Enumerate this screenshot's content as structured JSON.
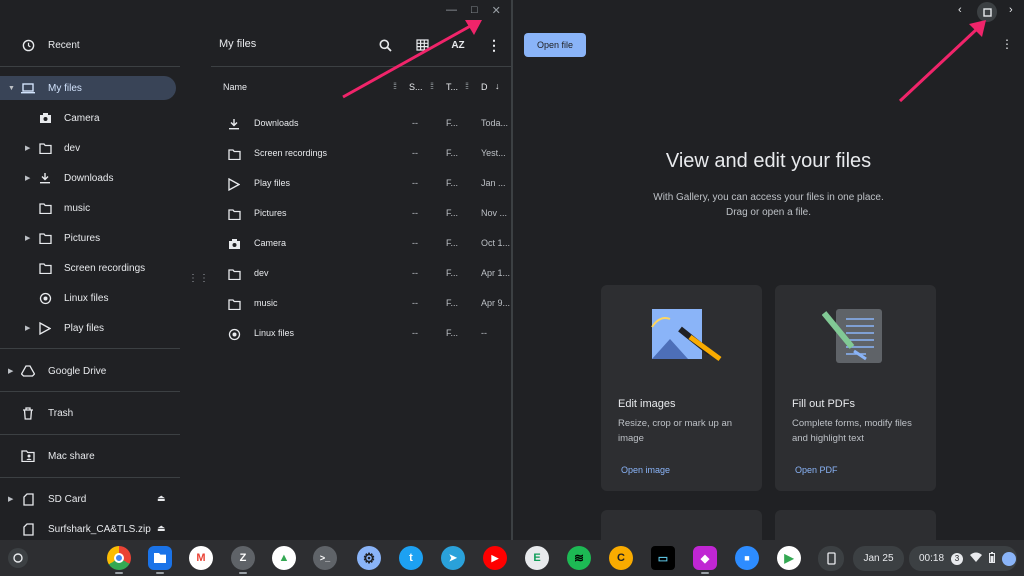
{
  "files": {
    "title": "My files",
    "sidebar": {
      "items": [
        {
          "label": "Recent",
          "icon": "clock-icon"
        },
        {
          "label": "My files",
          "icon": "laptop-icon"
        },
        {
          "label": "Camera",
          "icon": "camera-icon"
        },
        {
          "label": "dev",
          "icon": "folder-icon"
        },
        {
          "label": "Downloads",
          "icon": "download-icon"
        },
        {
          "label": "music",
          "icon": "folder-icon"
        },
        {
          "label": "Pictures",
          "icon": "folder-icon"
        },
        {
          "label": "Screen recordings",
          "icon": "folder-icon"
        },
        {
          "label": "Linux files",
          "icon": "penguin-icon"
        },
        {
          "label": "Play files",
          "icon": "play-store-icon"
        },
        {
          "label": "Google Drive",
          "icon": "drive-icon"
        },
        {
          "label": "Trash",
          "icon": "trash-icon"
        },
        {
          "label": "Mac share",
          "icon": "shared-folder-icon"
        },
        {
          "label": "SD Card",
          "icon": "sd-card-icon"
        },
        {
          "label": "Surfshark_CA&TLS.zip",
          "icon": "zip-icon"
        }
      ]
    },
    "columns": {
      "name": "Name",
      "size": "S...",
      "type": "T...",
      "date": "D"
    },
    "rows": [
      {
        "name": "Downloads",
        "size": "--",
        "type": "F...",
        "date": "Toda..."
      },
      {
        "name": "Screen recordings",
        "size": "--",
        "type": "F...",
        "date": "Yest..."
      },
      {
        "name": "Play files",
        "size": "--",
        "type": "F...",
        "date": "Jan ..."
      },
      {
        "name": "Pictures",
        "size": "--",
        "type": "F...",
        "date": "Nov ..."
      },
      {
        "name": "Camera",
        "size": "--",
        "type": "F...",
        "date": "Oct 1..."
      },
      {
        "name": "dev",
        "size": "--",
        "type": "F...",
        "date": "Apr 1..."
      },
      {
        "name": "music",
        "size": "--",
        "type": "F...",
        "date": "Apr 9..."
      },
      {
        "name": "Linux files",
        "size": "--",
        "type": "F...",
        "date": "--"
      }
    ],
    "sort_label": "AZ"
  },
  "gallery": {
    "open_button": "Open file",
    "heading": "View and edit your files",
    "subtitle_line1": "With Gallery, you can access your files in one place.",
    "subtitle_line2": "Drag or open a file.",
    "cards": [
      {
        "title": "Edit images",
        "desc": "Resize, crop or mark up an image",
        "link": "Open image"
      },
      {
        "title": "Fill out PDFs",
        "desc": "Complete forms, modify files and highlight text",
        "link": "Open PDF"
      }
    ]
  },
  "shelf": {
    "apps": [
      {
        "name": "chrome",
        "color": "#4285f4",
        "glyph": ""
      },
      {
        "name": "files",
        "color": "#1a73e8",
        "glyph": ""
      },
      {
        "name": "gmail",
        "color": "#ffffff",
        "glyph": "M"
      },
      {
        "name": "z",
        "color": "#5f6368",
        "glyph": "Z"
      },
      {
        "name": "drive",
        "color": "#ffffff",
        "glyph": "▲"
      },
      {
        "name": "terminal",
        "color": "#5f6368",
        "glyph": ">_"
      },
      {
        "name": "settings",
        "color": "#8ab4f8",
        "glyph": "⚙"
      },
      {
        "name": "twitter",
        "color": "#1da1f2",
        "glyph": "t"
      },
      {
        "name": "telegram",
        "color": "#2aa1da",
        "glyph": "➤"
      },
      {
        "name": "youtube",
        "color": "#ff0000",
        "glyph": "▶"
      },
      {
        "name": "e",
        "color": "#e8eaed",
        "glyph": "E"
      },
      {
        "name": "spotify",
        "color": "#1db954",
        "glyph": "≋"
      },
      {
        "name": "c",
        "color": "#f9ab00",
        "glyph": "C"
      },
      {
        "name": "monitor",
        "color": "#202124",
        "glyph": "▭"
      },
      {
        "name": "pink",
        "color": "#c026d3",
        "glyph": "◆"
      },
      {
        "name": "zoom",
        "color": "#2d8cff",
        "glyph": "■"
      },
      {
        "name": "play-store",
        "color": "#ffffff",
        "glyph": "▶"
      }
    ],
    "date": "Jan 25",
    "time": "00:18",
    "notif_count": "3"
  }
}
